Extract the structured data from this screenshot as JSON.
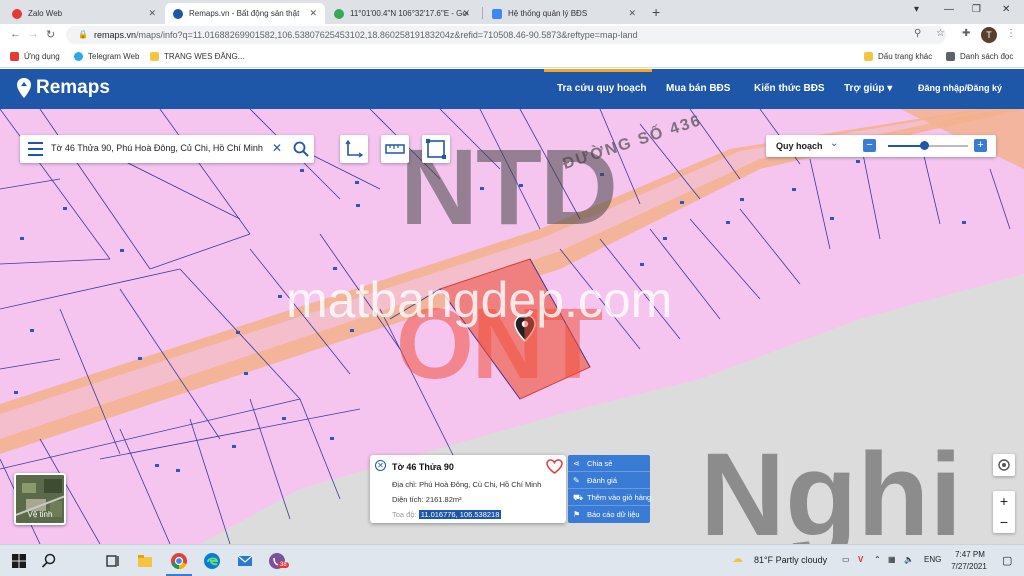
{
  "browser": {
    "tabs": [
      {
        "title": "Zalo Web",
        "color": "#e53935"
      },
      {
        "title": "Remaps.vn - Bất động sản thật",
        "color": "#1f57a8"
      },
      {
        "title": "11°01'00.4\"N 106°32'17.6\"E - Goo",
        "color": "#34a853"
      },
      {
        "title": "Hệ thống quản lý BĐS",
        "color": "#4285f4"
      }
    ],
    "url_host": "remaps.vn",
    "url_path": "/maps/info?q=11.01688269901582,106.53807625453102,18.86025819183204z&refid=710508.46-90.5873&reftype=map-land",
    "bookmarks": [
      {
        "label": "Ứng dụng",
        "color": "#e53935"
      },
      {
        "label": "Telegram Web",
        "color": "#29a9eb"
      },
      {
        "label": "TRANG WES ĐĂNG...",
        "color": "#f4c542"
      }
    ],
    "bookmarks_right": [
      {
        "label": "Dấu trang khác",
        "color": "#f4c542"
      },
      {
        "label": "Danh sách đọc",
        "color": "#5f6368"
      }
    ],
    "profile_initial": "T"
  },
  "site": {
    "logo": "Remaps",
    "nav": [
      "Tra cứu quy hoạch",
      "Mua bán BĐS",
      "Kiến thức BĐS",
      "Trợ giúp",
      "Đăng nhập/Đăng ký"
    ],
    "brand_color": "#1f57a8",
    "accent_color": "#f6a623"
  },
  "map": {
    "search_text": "Tờ 46 Thửa 90, Phú Hoà Đông, Củ Chi, Hồ Chí Minh",
    "layer_label": "Quy hoạch",
    "zoom_level": 0.45,
    "road_label": "ĐƯỜNG SỐ 436",
    "watermark_letters_1": "NTD",
    "watermark_letters_2": "ONT",
    "watermark_site": "matbangdep.com",
    "watermark_right": "Nghi",
    "satellite_label": "Vệ tinh",
    "zoom_in": "+",
    "zoom_out": "−",
    "zone_color": "#f5c5f0",
    "parcel_color": "#f08080"
  },
  "popup": {
    "title": "Tờ 46 Thửa 90",
    "address_label": "Địa chỉ:",
    "address_value": "Phú Hoà Đông, Củ Chi, Hồ Chí Minh",
    "area_label": "Diện tích:",
    "area_value": "2161.82m²",
    "coord_label": "Toạ độ:",
    "coord_value": "11.016776, 106.538218",
    "actions": [
      {
        "icon": "share-icon",
        "label": "Chia sẻ"
      },
      {
        "icon": "pencil-icon",
        "label": "Đánh giá"
      },
      {
        "icon": "cart-icon",
        "label": "Thêm vào giỏ hàng"
      },
      {
        "icon": "flag-icon",
        "label": "Báo cáo dữ liệu"
      }
    ]
  },
  "taskbar": {
    "weather": "81°F  Partly cloudy",
    "lang": "ENG",
    "time": "7:47 PM",
    "date": "7/27/2021",
    "badge_count": "38"
  }
}
